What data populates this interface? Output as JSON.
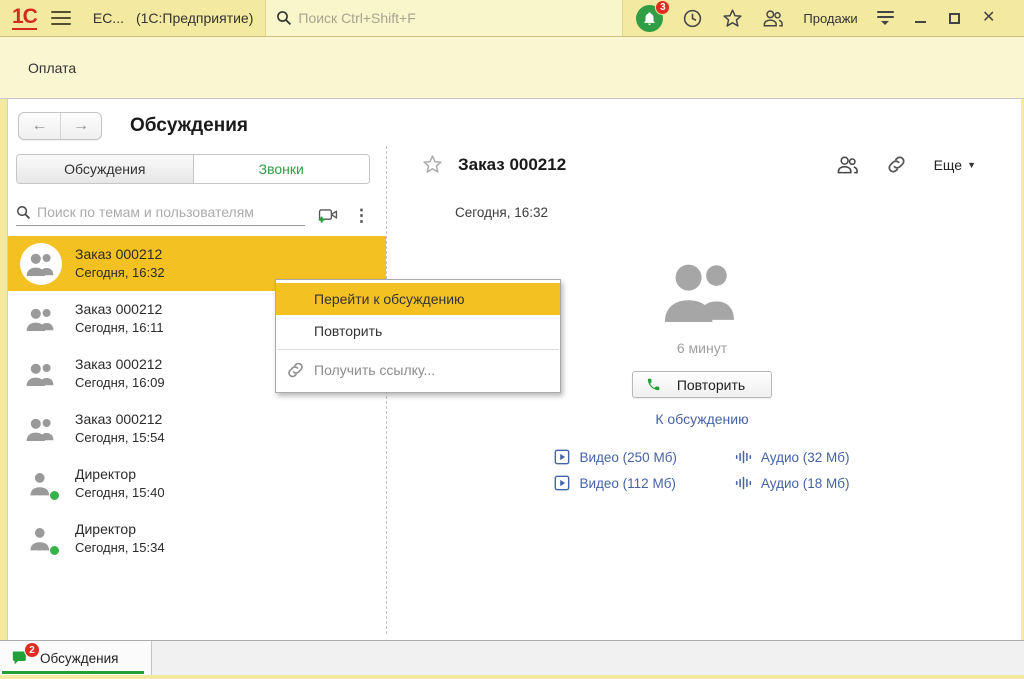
{
  "titlebar": {
    "logo": "1С",
    "app_title": "ЕС...",
    "app_context": "(1С:Предприятие)",
    "search_placeholder": "Поиск Ctrl+Shift+F",
    "notifications_count": "3",
    "section_label": "Продажи"
  },
  "subheader": {
    "tab_label": "Оплата"
  },
  "page": {
    "title": "Обсуждения"
  },
  "left_panel": {
    "tabs": [
      {
        "label": "Обсуждения"
      },
      {
        "label": "Звонки"
      }
    ],
    "active_tab": "Звонки",
    "search_placeholder": "Поиск по темам и пользователям",
    "items": [
      {
        "title": "Заказ 000212",
        "time": "Сегодня, 16:32",
        "avatar": "group",
        "selected": true
      },
      {
        "title": "Заказ 000212",
        "time": "Сегодня, 16:11",
        "avatar": "group",
        "selected": false
      },
      {
        "title": "Заказ 000212",
        "time": "Сегодня, 16:09",
        "avatar": "group",
        "selected": false
      },
      {
        "title": "Заказ 000212",
        "time": "Сегодня, 15:54",
        "avatar": "group",
        "selected": false
      },
      {
        "title": "Директор",
        "time": "Сегодня, 15:40",
        "avatar": "person-online",
        "selected": false
      },
      {
        "title": "Директор",
        "time": "Сегодня, 15:34",
        "avatar": "person-online",
        "selected": false
      }
    ]
  },
  "context_menu": {
    "items": [
      {
        "label": "Перейти к обсуждению",
        "highlighted": true
      },
      {
        "label": "Повторить",
        "highlighted": false
      },
      {
        "label": "Получить ссылку...",
        "icon": "link-icon",
        "highlighted": false
      }
    ]
  },
  "detail": {
    "title": "Заказ 000212",
    "timestamp": "Сегодня, 16:32",
    "duration": "6 минут",
    "repeat_button_label": "Повторить",
    "discussion_link_label": "К обсуждению",
    "more_button_label": "Еще",
    "attachments": [
      {
        "type": "video",
        "label": "Видео (250 Мб)"
      },
      {
        "type": "audio",
        "label": "Аудио (32 Мб)"
      },
      {
        "type": "video",
        "label": "Видео (112 Мб)"
      },
      {
        "type": "audio",
        "label": "Аудио (18 Мб)"
      }
    ]
  },
  "status_bar": {
    "tab_label": "Обсуждения",
    "unread_count": "2"
  },
  "icons": [
    "logo-1c",
    "hamburger-icon",
    "search-icon",
    "bell-icon",
    "history-icon",
    "star-icon",
    "people-icon",
    "service-menu-icon",
    "minimize-icon",
    "maximize-icon",
    "close-icon",
    "back-arrow-icon",
    "forward-arrow-icon",
    "new-video-call-icon",
    "kebab-icon",
    "group-avatar-icon",
    "person-avatar-icon",
    "presence-dot",
    "link-icon",
    "phone-icon",
    "video-play-icon",
    "audio-wave-icon",
    "chat-bubbles-icon"
  ],
  "colors": {
    "titlebar_yellow": "#F3E9A1",
    "subheader_yellow": "#FBF6D2",
    "accent_gold": "#F3C222",
    "accent_green": "#21A038",
    "icon_green": "#2F9E44",
    "link_blue": "#4663A8",
    "badge_red": "#E02B20",
    "logo_red": "#D6291F"
  }
}
